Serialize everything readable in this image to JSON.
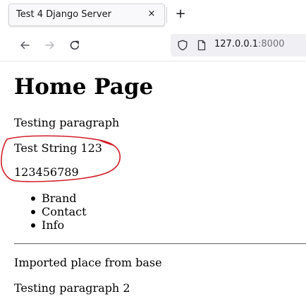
{
  "browser": {
    "tab": {
      "title": "Test 4 Django Server",
      "close_glyph": "×"
    },
    "new_tab_glyph": "+",
    "url": {
      "host": "127.0.0.1",
      "port": ":8000"
    },
    "icons": {
      "back": "arrow-left-icon",
      "forward": "arrow-right-icon",
      "reload": "reload-icon",
      "shield": "tracking-shield-icon",
      "page": "page-document-icon"
    }
  },
  "page": {
    "title": "Home Page",
    "paragraph_1": "Testing paragraph",
    "test_string": "Test String 123",
    "number_string": "123456789",
    "nav_items": [
      "Brand",
      "Contact",
      "Info"
    ],
    "base_text": "Imported place from base",
    "paragraph_2": "Testing paragraph 2"
  },
  "annotation": {
    "color": "#d21f2a"
  }
}
